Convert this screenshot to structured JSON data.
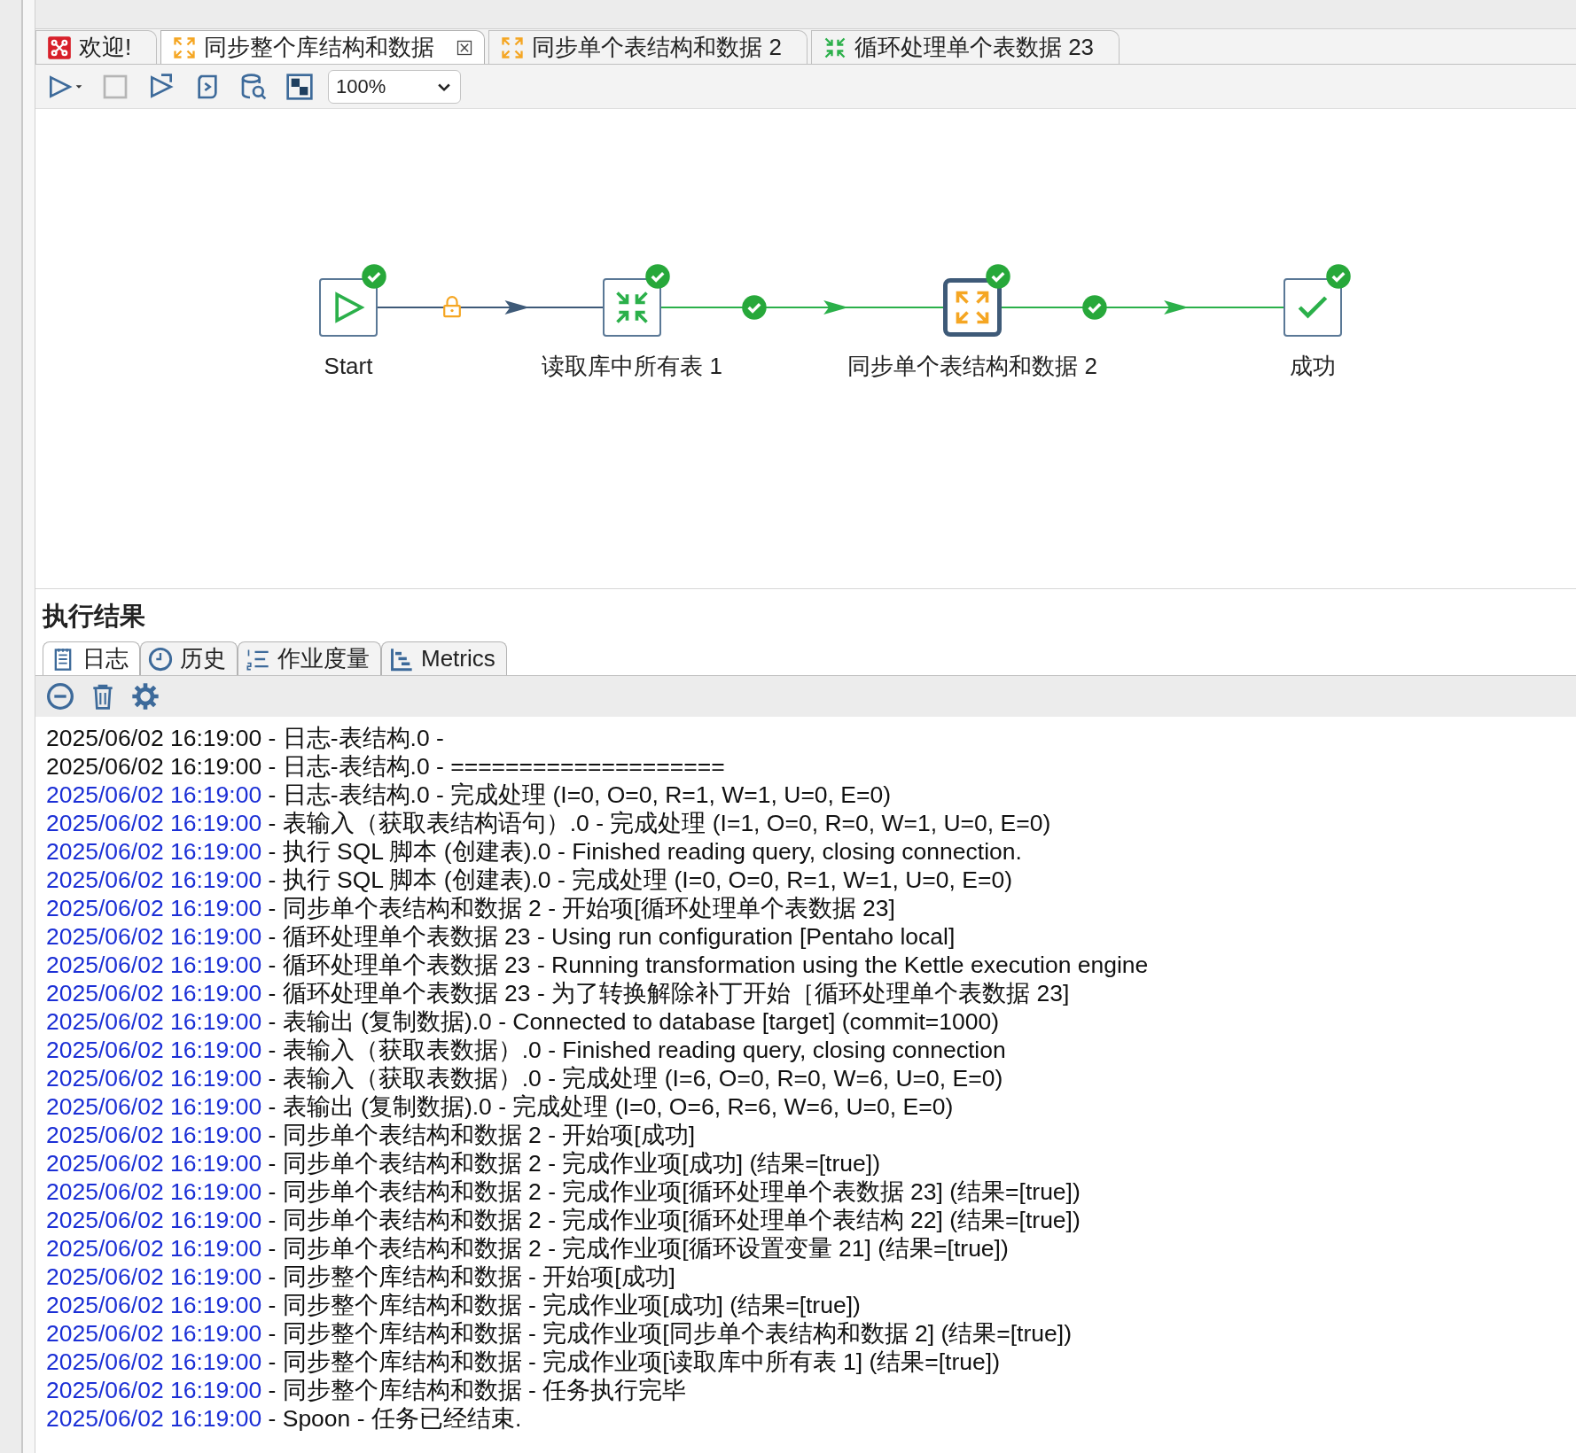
{
  "editor_tabs": [
    {
      "label": "欢迎!",
      "kind": "welcome",
      "selected": false,
      "closable": false
    },
    {
      "label": "同步整个库结构和数据",
      "kind": "job",
      "selected": true,
      "closable": true
    },
    {
      "label": "同步单个表结构和数据 2",
      "kind": "job",
      "selected": false,
      "closable": false
    },
    {
      "label": "循环处理单个表数据 23",
      "kind": "transformation",
      "selected": false,
      "closable": false
    }
  ],
  "toolbar": {
    "zoom": "100%"
  },
  "diagram": {
    "nodes": [
      {
        "label": "Start",
        "kind": "start",
        "selected": false,
        "done": true
      },
      {
        "label": "读取库中所有表 1",
        "kind": "transformation",
        "selected": false,
        "done": true
      },
      {
        "label": "同步单个表结构和数据 2",
        "kind": "job",
        "selected": true,
        "done": true
      },
      {
        "label": "成功",
        "kind": "success",
        "selected": false,
        "done": true
      }
    ],
    "hops": [
      {
        "kind": "unconditional"
      },
      {
        "kind": "success"
      },
      {
        "kind": "success"
      }
    ]
  },
  "results": {
    "title": "执行结果",
    "tabs": [
      {
        "label": "日志",
        "kind": "log",
        "selected": true
      },
      {
        "label": "历史",
        "kind": "history",
        "selected": false
      },
      {
        "label": "作业度量",
        "kind": "metrics-list",
        "selected": false
      },
      {
        "label": "Metrics",
        "kind": "metrics-chart",
        "selected": false
      }
    ],
    "log_lines": [
      {
        "time": "2025/06/02 16:19:00",
        "text": " - 日志-表结构.0 -",
        "color": "#111111"
      },
      {
        "time": "2025/06/02 16:19:00",
        "text": " - 日志-表结构.0 - ====================",
        "color": "#111111"
      },
      {
        "time": "2025/06/02 16:19:00",
        "text": " - 日志-表结构.0 - 完成处理 (I=0, O=0, R=1, W=1, U=0, E=0)",
        "color": "#1b2fd6"
      },
      {
        "time": "2025/06/02 16:19:00",
        "text": " - 表输入（获取表结构语句）.0 - 完成处理 (I=1, O=0, R=0, W=1, U=0, E=0)",
        "color": "#1b2fd6"
      },
      {
        "time": "2025/06/02 16:19:00",
        "text": " - 执行 SQL 脚本 (创建表).0 - Finished reading query, closing connection.",
        "color": "#1b2fd6"
      },
      {
        "time": "2025/06/02 16:19:00",
        "text": " - 执行 SQL 脚本 (创建表).0 - 完成处理 (I=0, O=0, R=1, W=1, U=0, E=0)",
        "color": "#1b2fd6"
      },
      {
        "time": "2025/06/02 16:19:00",
        "text": " - 同步单个表结构和数据 2 - 开始项[循环处理单个表数据 23]",
        "color": "#1b2fd6"
      },
      {
        "time": "2025/06/02 16:19:00",
        "text": " - 循环处理单个表数据 23 - Using run configuration [Pentaho local]",
        "color": "#1b2fd6"
      },
      {
        "time": "2025/06/02 16:19:00",
        "text": " - 循环处理单个表数据 23 - Running transformation using the Kettle execution engine",
        "color": "#1b2fd6"
      },
      {
        "time": "2025/06/02 16:19:00",
        "text": " - 循环处理单个表数据 23 - 为了转换解除补丁开始［循环处理单个表数据 23]",
        "color": "#1b2fd6"
      },
      {
        "time": "2025/06/02 16:19:00",
        "text": " - 表输出 (复制数据).0 - Connected to database [target] (commit=1000)",
        "color": "#1b2fd6"
      },
      {
        "time": "2025/06/02 16:19:00",
        "text": " - 表输入（获取表数据）.0 - Finished reading query, closing connection",
        "color": "#1b2fd6"
      },
      {
        "time": "2025/06/02 16:19:00",
        "text": " - 表输入（获取表数据）.0 - 完成处理 (I=6, O=0, R=0, W=6, U=0, E=0)",
        "color": "#1b2fd6"
      },
      {
        "time": "2025/06/02 16:19:00",
        "text": " - 表输出 (复制数据).0 - 完成处理 (I=0, O=6, R=6, W=6, U=0, E=0)",
        "color": "#1b2fd6"
      },
      {
        "time": "2025/06/02 16:19:00",
        "text": " - 同步单个表结构和数据 2 - 开始项[成功]",
        "color": "#1b2fd6"
      },
      {
        "time": "2025/06/02 16:19:00",
        "text": " - 同步单个表结构和数据 2 - 完成作业项[成功] (结果=[true])",
        "color": "#1b2fd6"
      },
      {
        "time": "2025/06/02 16:19:00",
        "text": " - 同步单个表结构和数据 2 - 完成作业项[循环处理单个表数据 23] (结果=[true])",
        "color": "#1b2fd6"
      },
      {
        "time": "2025/06/02 16:19:00",
        "text": " - 同步单个表结构和数据 2 - 完成作业项[循环处理单个表结构 22] (结果=[true])",
        "color": "#1b2fd6"
      },
      {
        "time": "2025/06/02 16:19:00",
        "text": " - 同步单个表结构和数据 2 - 完成作业项[循环设置变量 21] (结果=[true])",
        "color": "#1b2fd6"
      },
      {
        "time": "2025/06/02 16:19:00",
        "text": " - 同步整个库结构和数据 - 开始项[成功]",
        "color": "#1b2fd6"
      },
      {
        "time": "2025/06/02 16:19:00",
        "text": " - 同步整个库结构和数据 - 完成作业项[成功] (结果=[true])",
        "color": "#1b2fd6"
      },
      {
        "time": "2025/06/02 16:19:00",
        "text": " - 同步整个库结构和数据 - 完成作业项[同步单个表结构和数据 2] (结果=[true])",
        "color": "#1b2fd6"
      },
      {
        "time": "2025/06/02 16:19:00",
        "text": " - 同步整个库结构和数据 - 完成作业项[读取库中所有表 1] (结果=[true])",
        "color": "#1b2fd6"
      },
      {
        "time": "2025/06/02 16:19:00",
        "text": " - 同步整个库结构和数据 - 任务执行完毕",
        "color": "#1b2fd6"
      },
      {
        "time": "2025/06/02 16:19:00",
        "text": " - Spoon - 任务已经结束.",
        "color": "#1b2fd6"
      }
    ]
  }
}
